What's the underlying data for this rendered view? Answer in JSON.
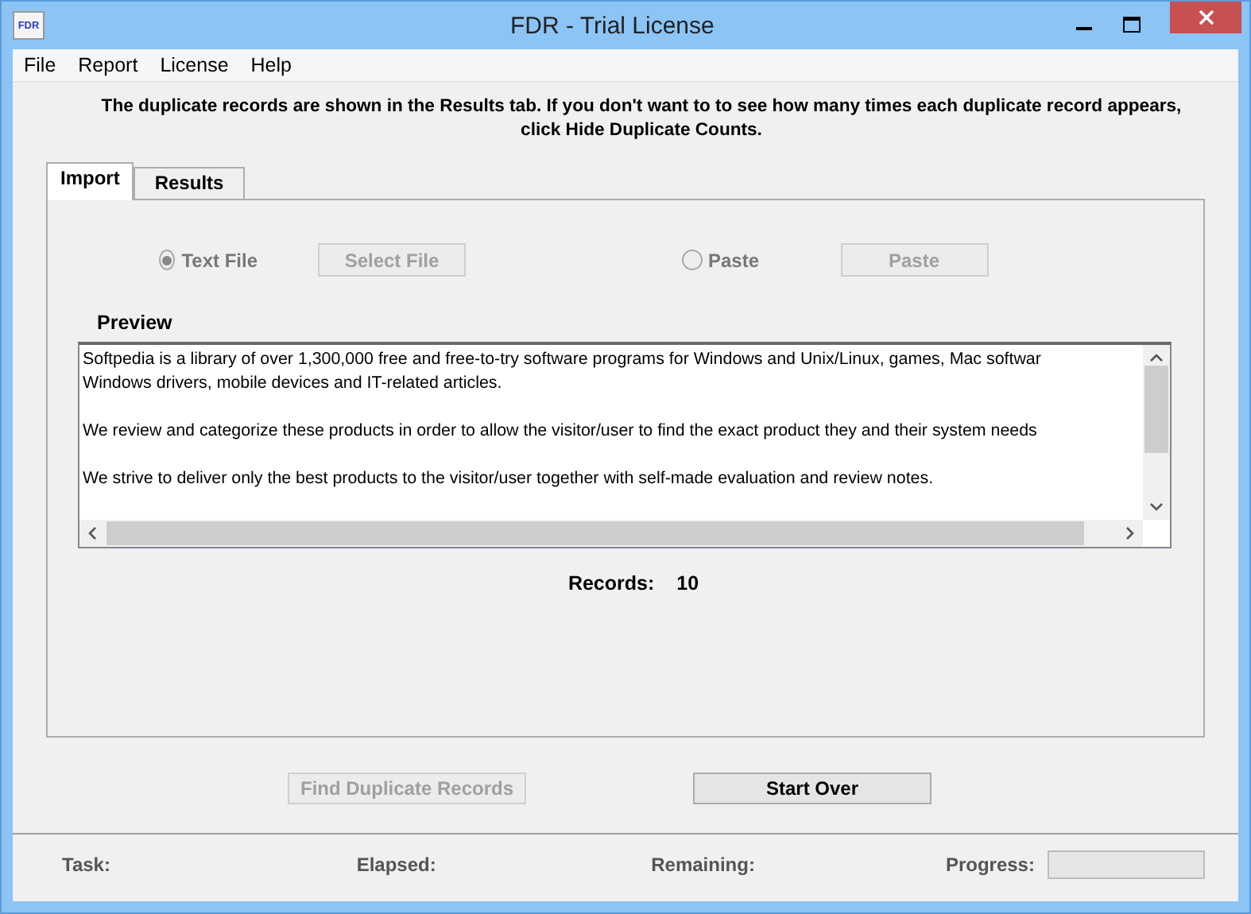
{
  "window": {
    "title": "FDR - Trial License",
    "icon_text": "FDR"
  },
  "menu": [
    "File",
    "Report",
    "License",
    "Help"
  ],
  "instructions": [
    "The duplicate records are shown in the Results tab. If you don't want to to see how many times each duplicate record appears,",
    "click Hide Duplicate Counts."
  ],
  "tabs": [
    {
      "label": "Import",
      "selected": true
    },
    {
      "label": "Results",
      "selected": false
    }
  ],
  "sources": [
    {
      "label": "Text File",
      "selected": true,
      "button": "Select File",
      "disabled": true
    },
    {
      "label": "Paste",
      "selected": false,
      "button": "Paste",
      "disabled": true
    }
  ],
  "preview": {
    "label": "Preview",
    "paragraphs": [
      {
        "lines": [
          "Softpedia is a library of over 1,300,000 free and free-to-try software programs for Windows and Unix/Linux, games, Mac softwar",
          "Windows drivers, mobile devices and IT-related articles."
        ]
      },
      {
        "lines": [
          "We review and categorize these products in order to allow the visitor/user to find the exact product they and their system needs"
        ]
      },
      {
        "lines": [
          "We strive to deliver only the best products to the visitor/user together with self-made evaluation and review notes."
        ]
      }
    ]
  },
  "records": {
    "label": "Records:",
    "value": "10"
  },
  "buttons": [
    {
      "label": "Find Duplicate Records",
      "disabled": true
    },
    {
      "label": "Start Over",
      "disabled": false
    }
  ],
  "status_bar": {
    "task": "Task:",
    "elapsed": "Elapsed:",
    "remaining": "Remaining:",
    "progress": "Progress:",
    "level": 0
  }
}
